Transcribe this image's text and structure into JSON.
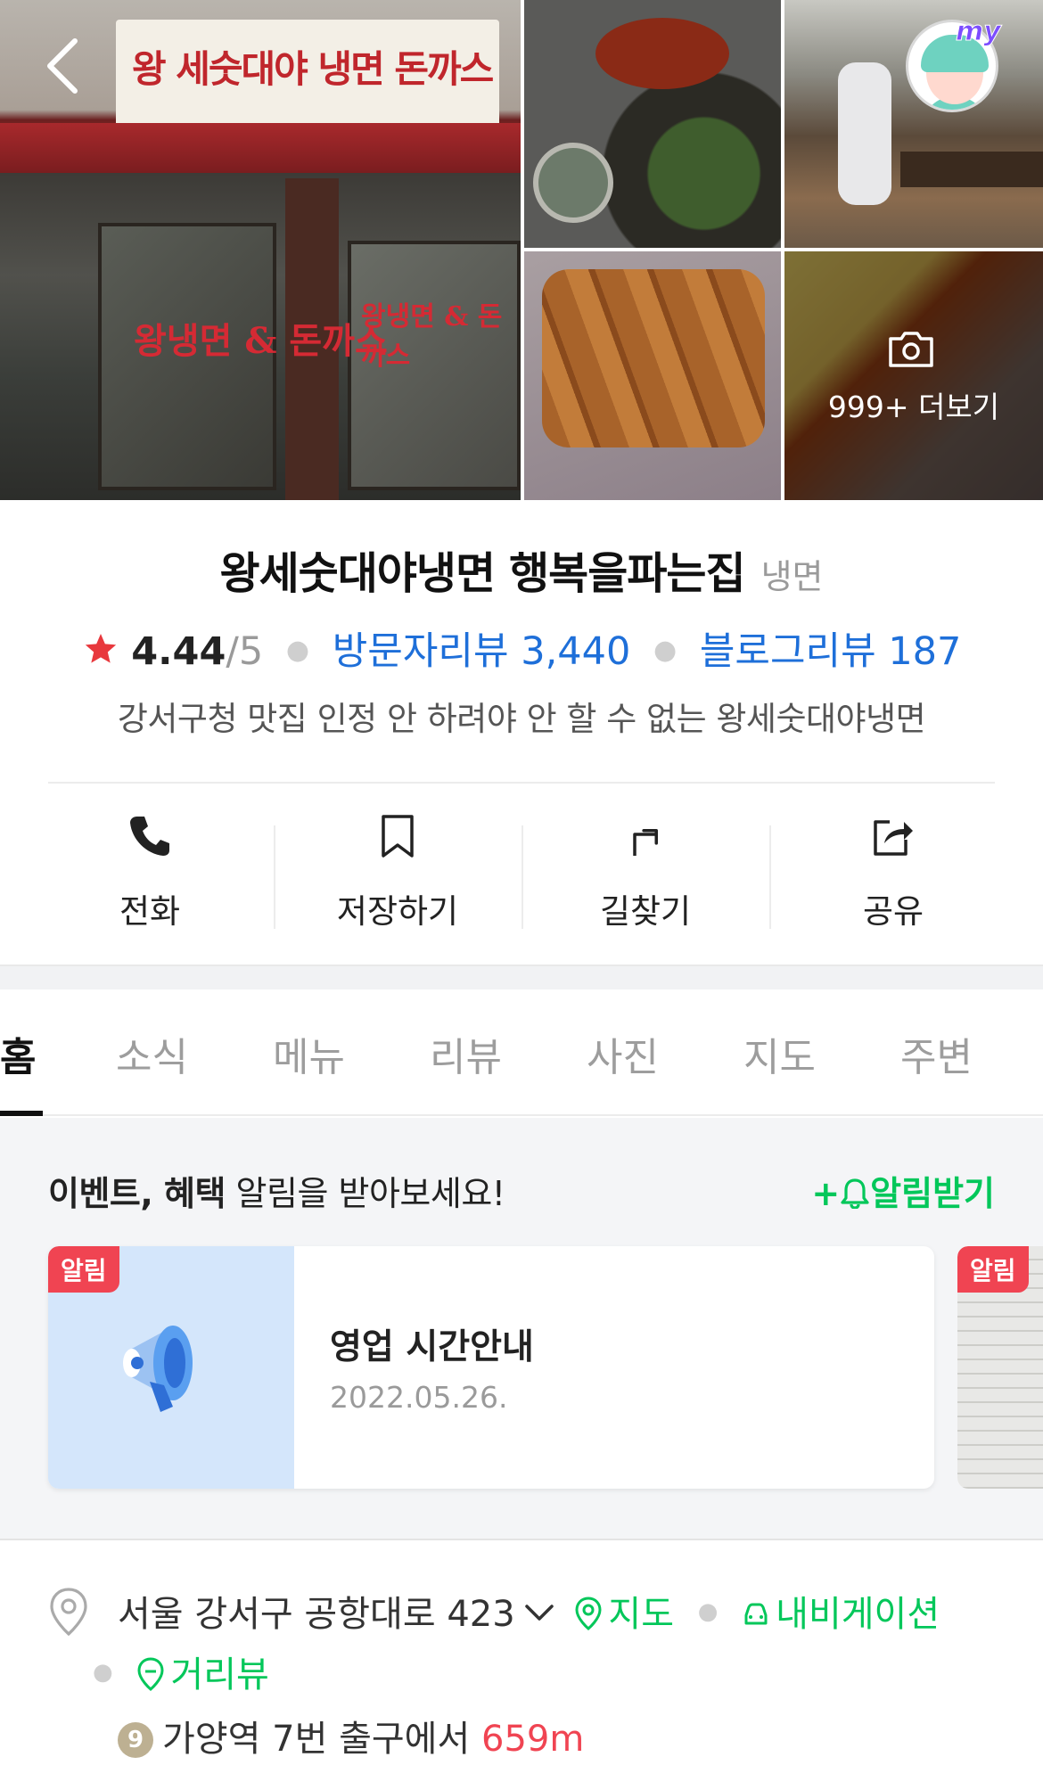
{
  "gallery": {
    "main_sign_text": "왕 세숫대야 냉면 돈까스",
    "window_text_left": "왕냉면 & 돈까스",
    "window_text_right": "왕냉면 & 돈까스",
    "more_photos_label": "999+ 더보기",
    "my_label": "my"
  },
  "place": {
    "name": "왕세숫대야냉면 행복을파는집",
    "category": "냉면",
    "rating": "4.44",
    "rating_max": "/5",
    "visitor_reviews": "방문자리뷰 3,440",
    "blog_reviews": "블로그리뷰 187",
    "intro": "강서구청 맛집 인정 안 하려야 안 할 수 없는 왕세숫대야냉면"
  },
  "actions": [
    {
      "label": "전화",
      "icon": "phone-icon"
    },
    {
      "label": "저장하기",
      "icon": "bookmark-icon"
    },
    {
      "label": "길찾기",
      "icon": "directions-icon"
    },
    {
      "label": "공유",
      "icon": "share-icon"
    }
  ],
  "tabs": [
    "홈",
    "소식",
    "메뉴",
    "리뷰",
    "사진",
    "지도",
    "주변"
  ],
  "active_tab": "홈",
  "events": {
    "title_bold": "이벤트, 혜택",
    "title_rest": " 알림을 받아보세요!",
    "subscribe_label": "알림받기",
    "cards": [
      {
        "badge": "알림",
        "title": "영업 시간안내",
        "date": "2022.05.26."
      },
      {
        "badge": "알림"
      }
    ]
  },
  "address": {
    "text": "서울 강서구 공항대로 423",
    "map_link": "지도",
    "navigation_link": "내비게이션",
    "street_view_link": "거리뷰",
    "subway_line": "9",
    "subway_text": "가양역 7번 출구에서",
    "distance": "659m"
  },
  "colors": {
    "accent_green": "#03c75a",
    "link_blue": "#1e6fd9",
    "badge_red": "#f04452",
    "star_red": "#e8383d"
  }
}
